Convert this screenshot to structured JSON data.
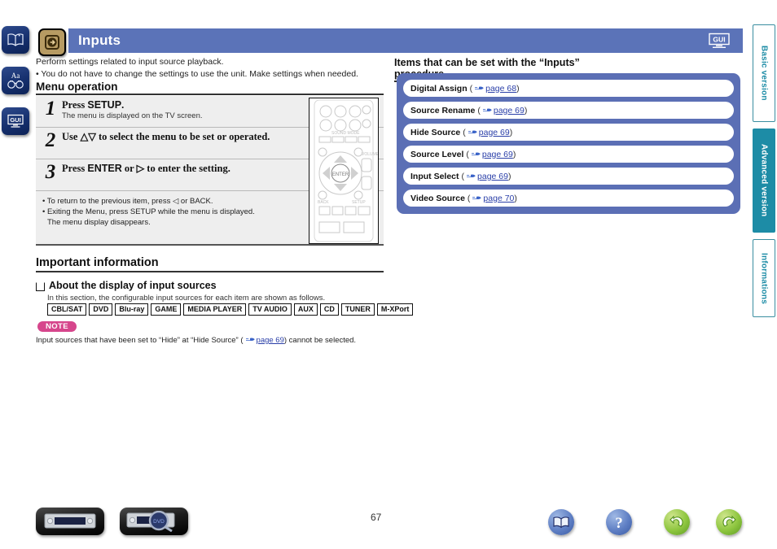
{
  "header": {
    "title": "Inputs",
    "icon": "input-source-icon",
    "gui_badge": "GUI"
  },
  "sidebar": {
    "items": [
      {
        "name": "manual-book-icon",
        "label": ""
      },
      {
        "name": "font-size-binoculars-icon",
        "label": "Aa"
      },
      {
        "name": "gui-monitor-icon",
        "label": "GUI"
      }
    ]
  },
  "intro": {
    "line1": "Perform settings related to input source playback.",
    "line2": "• You do not have to change the settings to use the unit. Make settings when needed."
  },
  "menu_operation": {
    "heading": "Menu operation",
    "steps": [
      {
        "num": "1",
        "title_pre": "Press ",
        "title_key": "SETUP",
        "title_post": ".",
        "sub": "The menu is displayed on the TV screen."
      },
      {
        "num": "2",
        "title_pre": "Use ",
        "title_key": "△▽",
        "title_post": " to select the menu to be set or operated.",
        "sub": ""
      },
      {
        "num": "3",
        "title_pre": "Press ",
        "title_key": "ENTER",
        "title_post": " or ▷ to enter the setting.",
        "sub": ""
      }
    ],
    "notes": [
      "• To return to the previous item, press ◁ or BACK.",
      "• Exiting the Menu, press SETUP while the menu is displayed.",
      "The menu display disappears."
    ],
    "note_keys": {
      "back": "BACK",
      "setup": "SETUP"
    }
  },
  "important_information": {
    "heading": "Important information",
    "sub_heading": "About the display of input sources",
    "description": "In this section, the configurable input sources for each item are shown as follows.",
    "source_tags": [
      "CBL/SAT",
      "DVD",
      "Blu-ray",
      "GAME",
      "MEDIA PLAYER",
      "TV AUDIO",
      "AUX",
      "CD",
      "TUNER",
      "M-XPort"
    ],
    "note_label": "NOTE",
    "note_text_pre": "Input sources that have been set to “Hide” at “Hide Source” (",
    "note_link": "page 69",
    "note_text_post": ") cannot be selected."
  },
  "items_panel": {
    "heading": "Items that can be set with the “Inputs” procedure",
    "items": [
      {
        "name": "Digital Assign",
        "ref": "page 68"
      },
      {
        "name": "Source Rename",
        "ref": "page 69"
      },
      {
        "name": "Hide Source",
        "ref": "page 69"
      },
      {
        "name": "Source Level",
        "ref": "page 69"
      },
      {
        "name": "Input Select",
        "ref": "page 69"
      },
      {
        "name": "Video Source",
        "ref": "page 70"
      }
    ]
  },
  "right_tabs": [
    {
      "label": "Basic version",
      "active": false
    },
    {
      "label": "Advanced version",
      "active": true
    },
    {
      "label": "Informations",
      "active": false
    }
  ],
  "footer": {
    "page_number": "67",
    "buttons": [
      {
        "name": "receiver-front-panel-button"
      },
      {
        "name": "receiver-display-magnify-button"
      }
    ],
    "nav_buttons": [
      {
        "name": "contents-book-button"
      },
      {
        "name": "help-question-button"
      },
      {
        "name": "back-arrow-button"
      },
      {
        "name": "forward-arrow-button"
      }
    ]
  },
  "colors": {
    "header_blue": "#5b73b8",
    "panel_blue": "#5b6fb5",
    "tab_teal": "#1d8ca6",
    "note_pink": "#d6468c",
    "link_blue": "#2a3fa8",
    "icon_gold": "#b79b63"
  }
}
